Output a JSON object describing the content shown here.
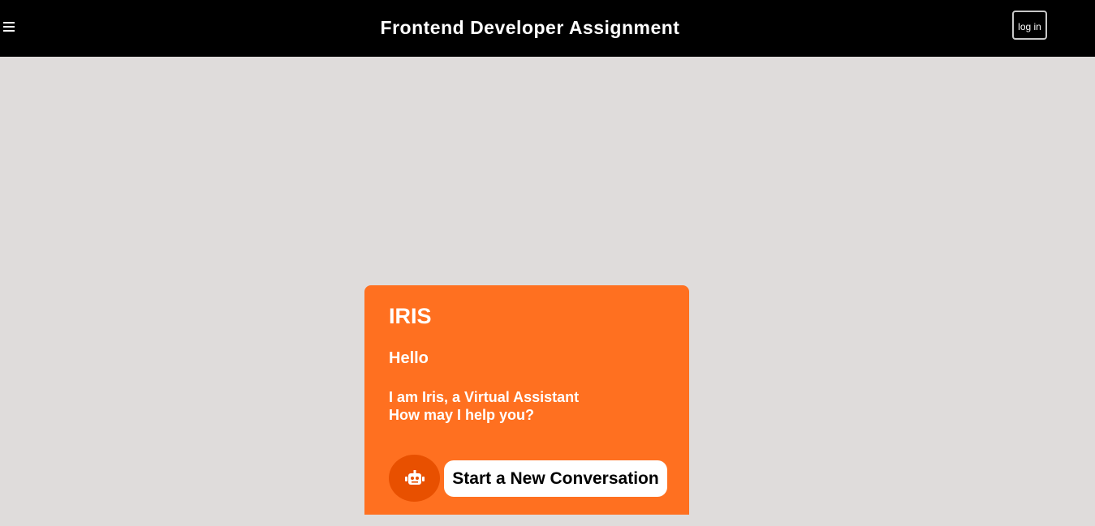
{
  "header": {
    "title": "Frontend Developer Assignment",
    "menu_icon": "hamburger-menu-icon",
    "login_label": "log in"
  },
  "card": {
    "title": "IRIS",
    "greeting": "Hello",
    "message_line1": "I am Iris, a Virtual Assistant",
    "message_line2": "How may I help you?",
    "avatar_icon": "robot-icon",
    "start_button_label": "Start a New Conversation"
  },
  "colors": {
    "header_bg": "#000000",
    "page_bg": "#dfdcdb",
    "card_bg": "#ff7020",
    "avatar_bg": "#e85000"
  }
}
